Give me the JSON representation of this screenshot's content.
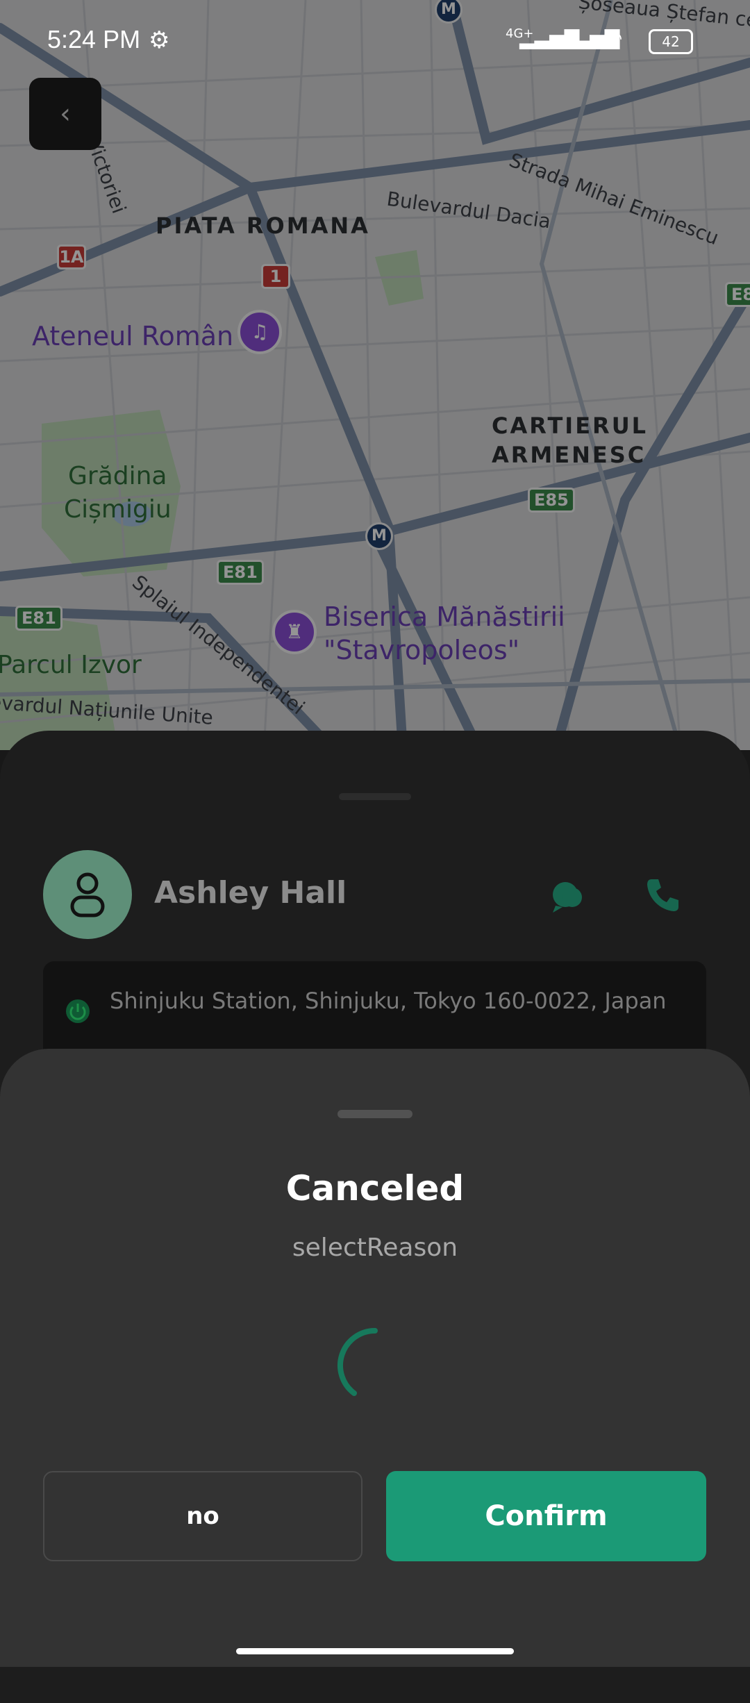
{
  "status_bar": {
    "time": "5:24 PM",
    "network": "4G+",
    "battery": "42"
  },
  "map": {
    "areas": [
      "PIATA ROMANA",
      "CARTIERUL",
      "ARMENESC"
    ],
    "streets": [
      "Bulevardul Dacia",
      "Strada Mihai Eminescu",
      "Victoriei",
      "Splaiul Independentei",
      "Bulevardul Națiunile Unite",
      "Șoseaua Ștefan cel Mare"
    ],
    "parks": [
      "Grădina",
      "Cișmigiu",
      "Parcul Izvor"
    ],
    "pois": [
      "Ateneul Român",
      "Biserica Mănăstirii",
      "\"Stavropoleos\""
    ],
    "route_shields": [
      "1A",
      "1",
      "E85",
      "E81",
      "E81",
      "E8"
    ],
    "metro_label": "M"
  },
  "driver": {
    "name": "Ashley Hall"
  },
  "address": {
    "text": "Shinjuku Station, Shinjuku, Tokyo 160-0022, Japan"
  },
  "cancel_dialog": {
    "title": "Canceled",
    "subtitle": "selectReason",
    "no_label": "no",
    "confirm_label": "Confirm"
  },
  "colors": {
    "accent": "#1b9a76",
    "sheet_bg": "#333333",
    "trip_sheet_bg": "#1d1d1d"
  }
}
